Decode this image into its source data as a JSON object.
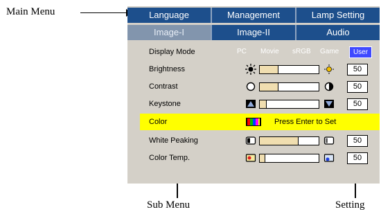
{
  "annotations": {
    "main_menu": "Main Menu",
    "sub_menu": "Sub Menu",
    "setting": "Setting"
  },
  "main_tabs": [
    "Language",
    "Management",
    "Lamp Setting"
  ],
  "sub_tabs": [
    "Image-I",
    "Image-II",
    "Audio"
  ],
  "display_mode": {
    "label": "Display Mode",
    "options": [
      "PC",
      "Movie",
      "sRGB",
      "Game"
    ],
    "selected": "User"
  },
  "brightness": {
    "label": "Brightness",
    "value": "50",
    "level": 0.3
  },
  "contrast": {
    "label": "Contrast",
    "value": "50",
    "level": 0.3
  },
  "keystone": {
    "label": "Keystone",
    "value": "50",
    "level": 0.1
  },
  "color": {
    "label": "Color",
    "action": "Press Enter to Set"
  },
  "white_peaking": {
    "label": "White Peaking",
    "value": "50",
    "level": 0.65
  },
  "color_temp": {
    "label": "Color Temp.",
    "value": "50",
    "level": 0.08
  },
  "colors": {
    "tab_bg": "#1d4f8c",
    "sub_active": "#8295ad",
    "panel": "#d4d0c8",
    "highlight": "#ffff00",
    "selected": "#3f49ff",
    "fill": "#f0deb0"
  }
}
